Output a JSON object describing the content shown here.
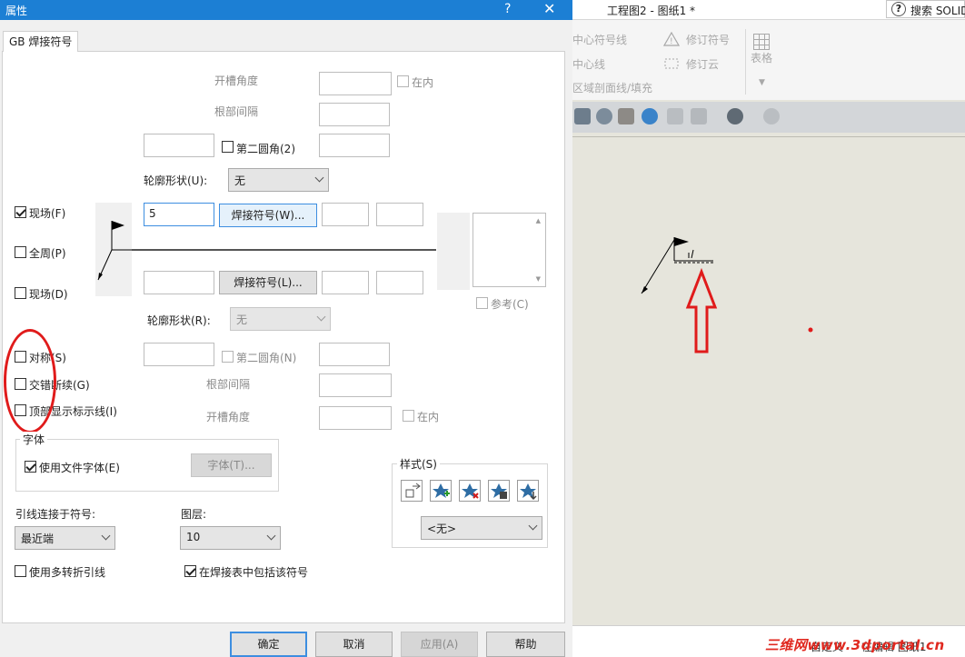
{
  "dialog": {
    "title": "属性",
    "help_glyph": "?",
    "close_glyph": "✕",
    "tab_label": "GB 焊接符号",
    "top": {
      "groove_angle_label": "开槽角度",
      "inside_label": "在内",
      "root_gap_label": "根部间隔",
      "second_fillet_label": "第二圆角(2)",
      "contour_label": "轮廓形状(U):",
      "contour_value": "无"
    },
    "left_checks": {
      "field": "现场(F)",
      "all_around": "全周(P)",
      "field_d": "现场(D)",
      "symmetric": "对称(S)",
      "staggered": "交错断续(G)",
      "top_indicator": "顶部显示标示线(I)"
    },
    "upper_row": {
      "value": "5",
      "weld_symbol_button": "焊接符号(W)..."
    },
    "lower_row": {
      "weld_symbol_button": "焊接符号(L)...",
      "contour_label": "轮廓形状(R):",
      "contour_value": "无",
      "second_fillet_label": "第二圆角(N)",
      "root_gap_label": "根部间隔",
      "groove_angle_label": "开槽角度",
      "inside_label": "在内"
    },
    "reference_label": "参考(C)",
    "font_group": {
      "title": "字体",
      "use_doc_font_label": "使用文件字体(E)",
      "font_button": "字体(T)..."
    },
    "style_group": {
      "title": "样式(S)",
      "select_value": "<无>"
    },
    "leader_label": "引线连接于符号:",
    "leader_value": "最近端",
    "layer_label": "图层:",
    "layer_value": "10",
    "multi_jog_label": "使用多转折引线",
    "include_in_table_label": "在焊接表中包括该符号",
    "buttons": {
      "ok": "确定",
      "cancel": "取消",
      "apply": "应用(A)",
      "help": "帮助"
    }
  },
  "app": {
    "title": "工程图2 - 图纸1 *",
    "search_label": "搜索 SOLIDWORKS",
    "ribbon": {
      "centerline": "中心符号线",
      "center_line": "中心线",
      "area_hatch": "区域剖面线/填充",
      "revision_symbol": "修订符号",
      "revision_cloud": "修订云",
      "table": "表格"
    },
    "status": {
      "custom": "自定义",
      "editing": "在编辑 图纸1"
    },
    "watermark": "三维网www.3dportal.cn"
  },
  "colors": {
    "title_bar": "#1c7fd4",
    "annotation_red": "#e01b1b",
    "canvas": "#e6e5dc"
  }
}
